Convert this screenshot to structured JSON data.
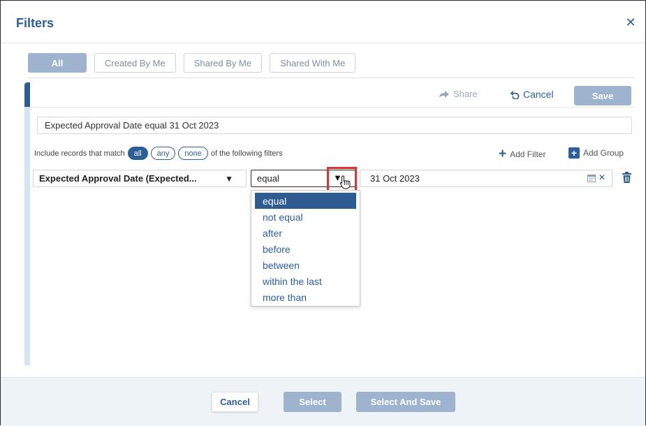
{
  "dialog": {
    "title": "Filters",
    "close_icon": "close-icon"
  },
  "tabs": [
    {
      "label": "All",
      "active": true
    },
    {
      "label": "Created By Me",
      "active": false
    },
    {
      "label": "Shared By Me",
      "active": false
    },
    {
      "label": "Shared With Me",
      "active": false
    }
  ],
  "toolbar": {
    "share_label": "Share",
    "cancel_label": "Cancel",
    "save_label": "Save"
  },
  "summary": "Expected Approval Date equal 31 Oct 2023",
  "match": {
    "prefix": "Include records that match",
    "options": [
      "all",
      "any",
      "none"
    ],
    "selected": "all",
    "suffix": "of the following filters"
  },
  "actions": {
    "add_filter": "Add Filter",
    "add_group": "Add Group"
  },
  "filter_row": {
    "field": "Expected Approval Date (Expected...",
    "operator": "equal",
    "value": "31 Oct 2023"
  },
  "operator_options": [
    "equal",
    "not equal",
    "after",
    "before",
    "between",
    "within the last",
    "more than"
  ],
  "footer": {
    "cancel_label": "Cancel",
    "select_label": "Select",
    "select_and_save_label": "Select And Save"
  },
  "colors": {
    "brand": "#2c5f99",
    "disabled_button": "#9eb3cd",
    "highlight_box": "#e03030"
  }
}
